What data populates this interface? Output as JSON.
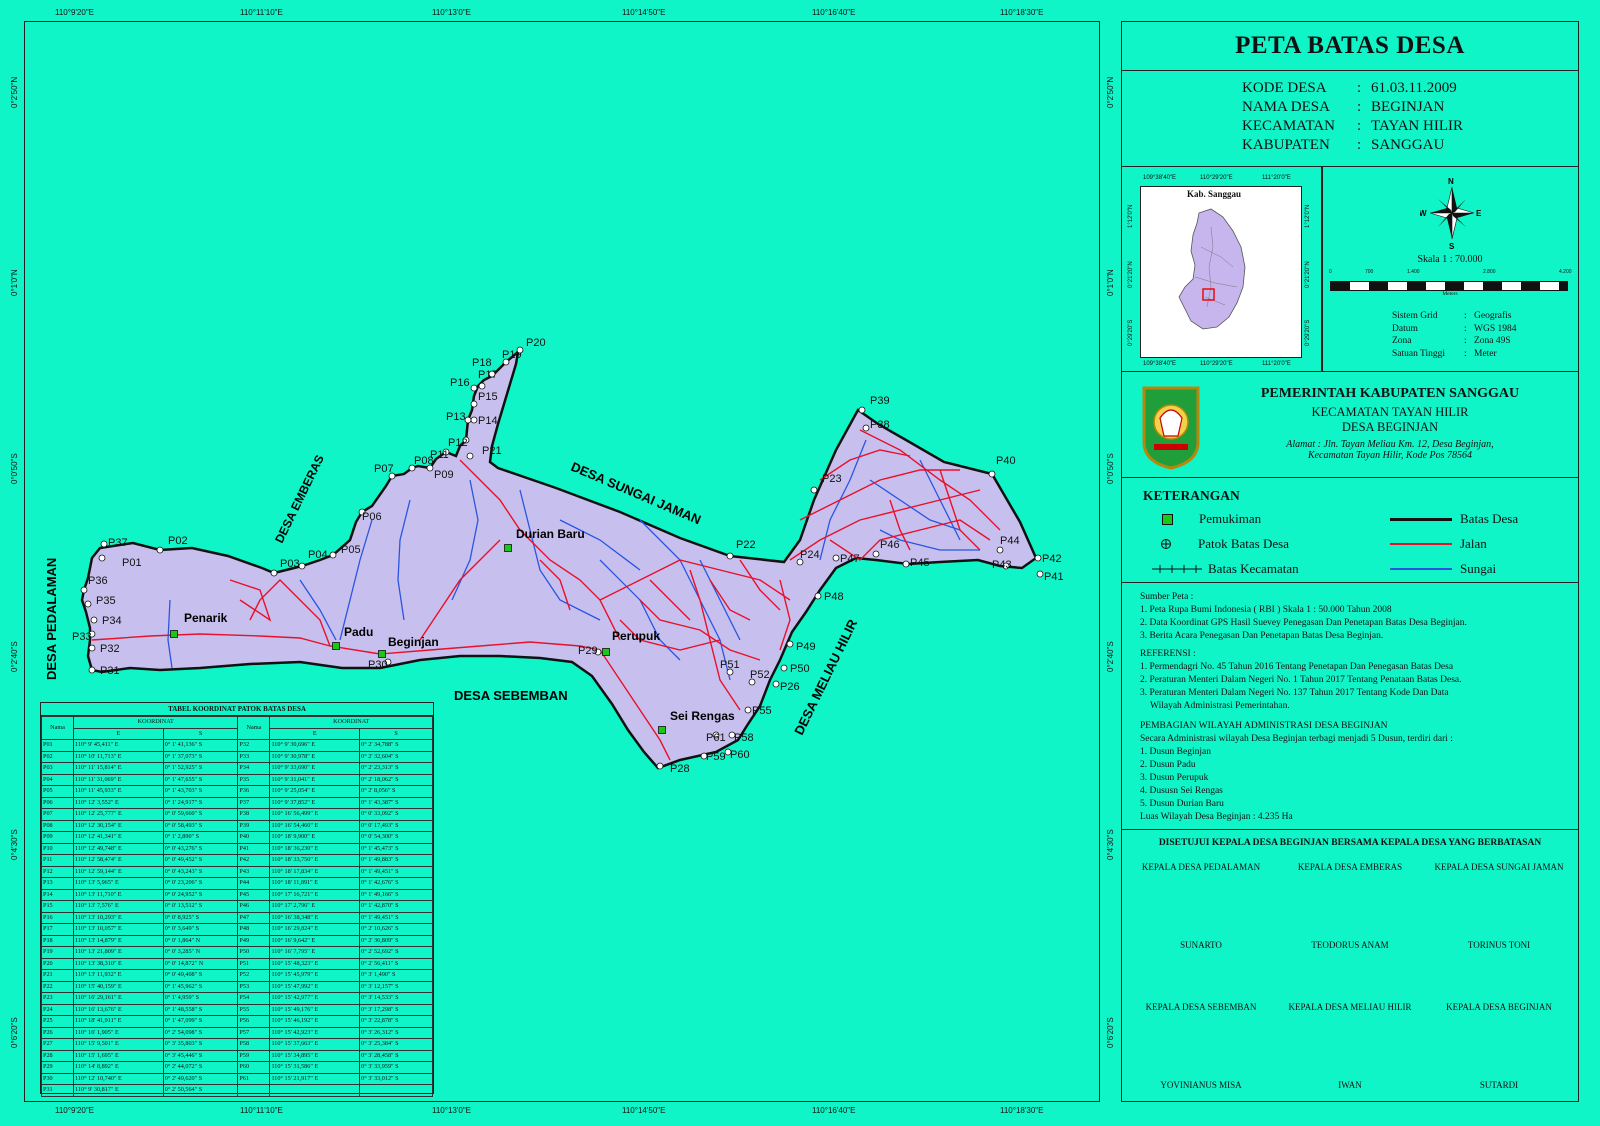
{
  "map": {
    "lon_ticks": [
      "110°9'20\"E",
      "110°11'10\"E",
      "110°13'0\"E",
      "110°14'50\"E",
      "110°16'40\"E",
      "110°18'30\"E"
    ],
    "lat_ticks": [
      "0°2'50\"N",
      "0°1'0\"N",
      "0°0'50\"S",
      "0°2'40\"S",
      "0°4'30\"S",
      "0°6'20\"S"
    ],
    "region_labels": {
      "pedalaman": "DESA PEDALAMAN",
      "emberas": "DESA EMBERAS",
      "sungai_jaman": "DESA SUNGAI JAMAN",
      "sebemban": "DESA SEBEMBAN",
      "meliau_hilir": "DESA MELIAU HILIR"
    },
    "settlements": [
      "Penarik",
      "Padu",
      "Beginjan",
      "Durian Baru",
      "Perupuk",
      "Sei Rengas"
    ],
    "points": [
      "P01",
      "P02",
      "P03",
      "P04",
      "P05",
      "P06",
      "P07",
      "P08",
      "P09",
      "P11",
      "P12",
      "P13",
      "P14",
      "P15",
      "P16",
      "P17",
      "P18",
      "P19",
      "P20",
      "P21",
      "P22",
      "P23",
      "P24",
      "P26",
      "P28",
      "P29",
      "P30",
      "P31",
      "P32",
      "P33",
      "P34",
      "P35",
      "P36",
      "P37",
      "P38",
      "P39",
      "P40",
      "P41",
      "P42",
      "P43",
      "P44",
      "P45",
      "P46",
      "P47",
      "P48",
      "P49",
      "P50",
      "P51",
      "P52",
      "P55",
      "P58",
      "P59",
      "P60",
      "P61"
    ]
  },
  "table": {
    "title": "TABEL KOORDINAT PATOK BATAS DESA",
    "col_nama": "Nama",
    "col_koordinat": "KOORDINAT",
    "col_e": "E",
    "col_s": "S",
    "left_rows": [
      [
        "P01",
        "110° 9' 45,411\" E",
        "0° 1' 41,136\" S"
      ],
      [
        "P02",
        "110° 10' 11,713\" E",
        "0° 1' 37,073\" S"
      ],
      [
        "P03",
        "110° 11' 15,814\" E",
        "0° 1' 52,925\" S"
      ],
      [
        "P04",
        "110° 11' 31,069\" E",
        "0° 1' 47,655\" S"
      ],
      [
        "P05",
        "110° 11' 45,933\" E",
        "0° 1' 43,703\" S"
      ],
      [
        "P06",
        "110° 12' 3,552\" E",
        "0° 1' 24,917\" S"
      ],
      [
        "P07",
        "110° 12' 25,777\" E",
        "0° 0' 59,660\" S"
      ],
      [
        "P08",
        "110° 12' 30,154\" E",
        "0° 0' 58,493\" S"
      ],
      [
        "P09",
        "110° 12' 41,341\" E",
        "0° 1' 2,890\" S"
      ],
      [
        "P10",
        "110° 12' 49,748\" E",
        "0° 0' 43,276\" S"
      ],
      [
        "P11",
        "110° 12' 58,474\" E",
        "0° 0' 49,452\" S"
      ],
      [
        "P12",
        "110° 12' 59,144\" E",
        "0° 0' 43,243\" S"
      ],
      [
        "P13",
        "110° 13' 5,965\" E",
        "0° 0' 23,206\" S"
      ],
      [
        "P14",
        "110° 13' 11,710\" E",
        "0° 0' 24,952\" S"
      ],
      [
        "P15",
        "110° 13' 7,576\" E",
        "0° 0' 13,512\" S"
      ],
      [
        "P16",
        "110° 13' 10,293\" E",
        "0° 0' 8,925\" S"
      ],
      [
        "P17",
        "110° 13' 10,057\" E",
        "0° 0' 3,649\" S"
      ],
      [
        "P18",
        "110° 13' 14,879\" E",
        "0° 0' 1,864\" N"
      ],
      [
        "P19",
        "110° 13' 21,809\" E",
        "0° 0' 3,285\" N"
      ],
      [
        "P20",
        "110° 13' 38,310\" E",
        "0° 0' 14,872\" N"
      ],
      [
        "P21",
        "110° 13' 11,932\" E",
        "0° 0' 49,498\" S"
      ],
      [
        "P22",
        "110° 15' 40,159\" E",
        "0° 1' 45,962\" S"
      ],
      [
        "P23",
        "110° 16' 29,161\" E",
        "0° 1' 4,959\" S"
      ],
      [
        "P24",
        "110° 16' 13,676\" E",
        "0° 1' 48,558\" S"
      ],
      [
        "P25",
        "110° 18' 41,911\" E",
        "0° 1' 47,099\" S"
      ],
      [
        "P26",
        "110° 16' 1,905\" E",
        "0° 2' 54,098\" S"
      ],
      [
        "P27",
        "110° 15' 9,501\" E",
        "0° 3' 35,803\" S"
      ],
      [
        "P28",
        "110° 15' 1,695\" E",
        "0° 3' 45,446\" S"
      ],
      [
        "P29",
        "110° 14' 8,892\" E",
        "0° 2' 44,072\" S"
      ],
      [
        "P30",
        "110° 12' 10,740\" E",
        "0° 2' 49,620\" S"
      ],
      [
        "P31",
        "110° 9' 30,817\" E",
        "0° 2' 50,564\" S"
      ]
    ],
    "right_rows": [
      [
        "P32",
        "110° 9' 30,696\" E",
        "0° 2' 34,788\" S"
      ],
      [
        "P33",
        "110° 9' 30,978\" E",
        "0° 2' 32,604\" S"
      ],
      [
        "P34",
        "110° 9' 33,690\" E",
        "0° 2' 23,313\" S"
      ],
      [
        "P35",
        "110° 9' 31,041\" E",
        "0° 2' 18,062\" S"
      ],
      [
        "P36",
        "110° 9' 25,054\" E",
        "0° 2' 8,056\" S"
      ],
      [
        "P37",
        "110° 9' 37,852\" E",
        "0° 1' 43,387\" S"
      ],
      [
        "P38",
        "110° 16' 56,499\" E",
        "0° 0' 33,092\" S"
      ],
      [
        "P39",
        "110° 16' 54,460\" E",
        "0° 0' 17,493\" S"
      ],
      [
        "P40",
        "110° 18' 9,900\" E",
        "0° 0' 54,300\" S"
      ],
      [
        "P41",
        "110° 18' 36,230\" E",
        "0° 1' 45,473\" S"
      ],
      [
        "P42",
        "110° 18' 33,750\" E",
        "0° 1' 49,883\" S"
      ],
      [
        "P43",
        "110° 18' 17,834\" E",
        "0° 1' 49,451\" S"
      ],
      [
        "P44",
        "110° 18' 11,891\" E",
        "0° 1' 42,676\" S"
      ],
      [
        "P45",
        "110° 17' 16,721\" E",
        "0° 1' 49,166\" S"
      ],
      [
        "P46",
        "110° 17' 2,796\" E",
        "0° 1' 42,870\" S"
      ],
      [
        "P47",
        "110° 16' 38,348\" E",
        "0° 1' 49,451\" S"
      ],
      [
        "P48",
        "110° 16' 29,824\" E",
        "0° 2' 10,626\" S"
      ],
      [
        "P49",
        "110° 16' 9,642\" E",
        "0° 2' 36,809\" S"
      ],
      [
        "P50",
        "110° 16' 7,795\" E",
        "0° 2' 52,692\" S"
      ],
      [
        "P51",
        "110° 15' 48,323\" E",
        "0° 2' 56,411\" S"
      ],
      [
        "P52",
        "110° 15' 45,979\" E",
        "0° 3' 1,490\" S"
      ],
      [
        "P53",
        "110° 15' 47,992\" E",
        "0° 3' 12,157\" S"
      ],
      [
        "P54",
        "110° 15' 42,977\" E",
        "0° 3' 14,533\" S"
      ],
      [
        "P55",
        "110° 15' 49,176\" E",
        "0° 3' 17,298\" S"
      ],
      [
        "P56",
        "110° 15' 46,192\" E",
        "0° 3' 22,878\" S"
      ],
      [
        "P57",
        "110° 15' 42,923\" E",
        "0° 3' 26,312\" S"
      ],
      [
        "P58",
        "110° 15' 37,663\" E",
        "0° 3' 25,384\" S"
      ],
      [
        "P59",
        "110° 15' 34,895\" E",
        "0° 3' 28,458\" S"
      ],
      [
        "P60",
        "110° 15' 31,586\" E",
        "0° 3' 33,959\" S"
      ],
      [
        "P61",
        "110° 15' 21,917\" E",
        "0° 3' 33,012\" S"
      ]
    ]
  },
  "panel": {
    "title": "PETA BATAS DESA",
    "info": [
      {
        "k": "KODE DESA",
        "v": "61.03.11.2009"
      },
      {
        "k": "NAMA DESA",
        "v": "BEGINJAN"
      },
      {
        "k": "KECAMATAN",
        "v": "TAYAN HILIR"
      },
      {
        "k": "KABUPATEN",
        "v": "SANGGAU"
      }
    ],
    "inset": {
      "title": "Kab. Sanggau",
      "top_ticks": [
        "109°38'40\"E",
        "110°29'20\"E",
        "111°20'0\"E"
      ],
      "left_ticks": [
        "1°12'0\"N",
        "0°21'20\"N",
        "0°29'20\"S"
      ]
    },
    "compass": {
      "n": "N",
      "s": "S",
      "e": "E",
      "w": "W"
    },
    "scale": {
      "label": "Skala 1 : 70.000",
      "ticks": [
        "0",
        "700",
        "1.400",
        "2.800",
        "4.200"
      ],
      "unit": "Meters"
    },
    "grid_info": [
      {
        "k": "Sistem Grid",
        "v": "Geografis"
      },
      {
        "k": "Datum",
        "v": "WGS 1984"
      },
      {
        "k": "Zona",
        "v": "Zona 49S"
      },
      {
        "k": "Satuan Tinggi",
        "v": "Meter"
      }
    ],
    "gov": {
      "line1": "PEMERINTAH KABUPATEN SANGGAU",
      "line2": "KECAMATAN TAYAN HILIR",
      "line3": "DESA BEGINJAN",
      "addr1": "Alamat : Jln. Tayan Meliau Km. 12, Desa Beginjan,",
      "addr2": "Kecamatan Tayan Hilir, Kode Pos 78564"
    },
    "legend": {
      "title": "KETERANGAN",
      "items": [
        "Pemukiman",
        "Patok Batas Desa",
        "Batas Kecamatan",
        "Batas Desa",
        "Jalan",
        "Sungai"
      ]
    },
    "sources": {
      "title": "Sumber Peta :",
      "lines": [
        "1. Peta Rupa Bumi Indonesia ( RBI ) Skala 1 : 50.000 Tahun 2008",
        "2. Data Koordinat GPS Hasil Suevey Penegasan Dan Penetapan Batas Desa Beginjan.",
        "3. Berita Acara Penegasan Dan Penetapan Batas Desa Beginjan."
      ],
      "ref_title": "REFERENSI :",
      "refs": [
        "1. Permendagri No. 45 Tahun 2016 Tentang Penetapan Dan Penegasan Batas Desa",
        "2. Peraturan Menteri Dalam Negeri No. 1 Tahun 2017 Tentang Penataan Batas Desa.",
        "3. Peraturan Menteri Dalam Negeri No. 137 Tahun 2017 Tentang Kode Dan Data",
        "    Wilayah Administrasi Pemerintahan."
      ],
      "div_title": "PEMBAGIAN WILAYAH ADMINISTRASI DESA BEGINJAN",
      "div_intro": "Secara Administrasi wilayah Desa Beginjan terbagi menjadi 5 Dusun, terdiri dari :",
      "dusun": [
        "1. Dusun Beginjan",
        "2. Dusun Padu",
        "3. Dusun Perupuk",
        "4. Dususn Sei Rengas",
        "5. Dusun Durian Baru"
      ],
      "luas": "Luas Wilayah Desa Beginjan : 4.235 Ha"
    },
    "approval": {
      "title": "DISETUJUI KEPALA DESA BEGINJAN BERSAMA KEPALA DESA YANG BERBATASAN",
      "row1_titles": [
        "KEPALA DESA PEDALAMAN",
        "KEPALA DESA EMBERAS",
        "KEPALA DESA SUNGAI JAMAN"
      ],
      "row1_names": [
        "SUNARTO",
        "TEODORUS ANAM",
        "TORINUS TONI"
      ],
      "row2_titles": [
        "KEPALA DESA SEBEMBAN",
        "KEPALA DESA MELIAU HILIR",
        "KEPALA DESA BEGINJAN"
      ],
      "row2_names": [
        "YOVINIANUS MISA",
        "IWAN",
        "SUTARDI"
      ]
    }
  },
  "colors": {
    "background": "#0ff5c8",
    "village_fill": "#c7c0ee",
    "road": "#e8102a",
    "river": "#2a55e0",
    "boundary": "#111111",
    "settlement": "#19c919"
  }
}
